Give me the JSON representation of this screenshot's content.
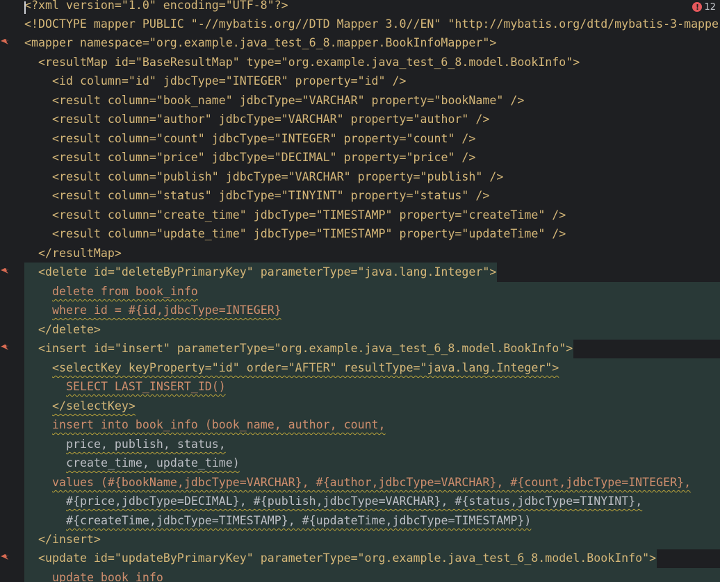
{
  "editor": {
    "problems_count": "12",
    "lines": [
      "<?xml version=\"1.0\" encoding=\"UTF-8\"?>",
      "<!DOCTYPE mapper PUBLIC \"-//mybatis.org//DTD Mapper 3.0//EN\" \"http://mybatis.org/dtd/mybatis-3-mappe",
      "<mapper namespace=\"org.example.java_test_6_8.mapper.BookInfoMapper\">",
      "<resultMap id=\"BaseResultMap\" type=\"org.example.java_test_6_8.model.BookInfo\">",
      "<id column=\"id\" jdbcType=\"INTEGER\" property=\"id\" />",
      "<result column=\"book_name\" jdbcType=\"VARCHAR\" property=\"bookName\" />",
      "<result column=\"author\" jdbcType=\"VARCHAR\" property=\"author\" />",
      "<result column=\"count\" jdbcType=\"INTEGER\" property=\"count\" />",
      "<result column=\"price\" jdbcType=\"DECIMAL\" property=\"price\" />",
      "<result column=\"publish\" jdbcType=\"VARCHAR\" property=\"publish\" />",
      "<result column=\"status\" jdbcType=\"TINYINT\" property=\"status\" />",
      "<result column=\"create_time\" jdbcType=\"TIMESTAMP\" property=\"createTime\" />",
      "<result column=\"update_time\" jdbcType=\"TIMESTAMP\" property=\"updateTime\" />",
      "</resultMap>",
      "<delete id=\"deleteByPrimaryKey\" parameterType=\"java.lang.Integer\">",
      "delete from book_info",
      "where id = #{id,jdbcType=INTEGER}",
      "</delete>",
      "<insert id=\"insert\" parameterType=\"org.example.java_test_6_8.model.BookInfo\">",
      "<selectKey keyProperty=\"id\" order=\"AFTER\" resultType=\"java.lang.Integer\">",
      "SELECT LAST_INSERT_ID()",
      "</selectKey>",
      "insert into book_info (book_name, author, count,",
      "price, publish, status,",
      "create_time, update_time)",
      "values (#{bookName,jdbcType=VARCHAR}, #{author,jdbcType=VARCHAR}, #{count,jdbcType=INTEGER},",
      "#{price,jdbcType=DECIMAL}, #{publish,jdbcType=VARCHAR}, #{status,jdbcType=TINYINT},",
      "#{createTime,jdbcType=TIMESTAMP}, #{updateTime,jdbcType=TIMESTAMP})",
      "</insert>",
      "<update id=\"updateByPrimaryKey\" parameterType=\"org.example.java_test_6_8.model.BookInfo\">",
      "update book_info"
    ]
  },
  "colors": {
    "background": "#1e1f22",
    "tag": "#d5b778",
    "string": "#6aab73",
    "keyword": "#cf8e6d",
    "function": "#56a8f5",
    "highlight": "#293937",
    "error": "#e5585c"
  },
  "icons": [
    "mybatis-bird-icon",
    "error-icon"
  ]
}
